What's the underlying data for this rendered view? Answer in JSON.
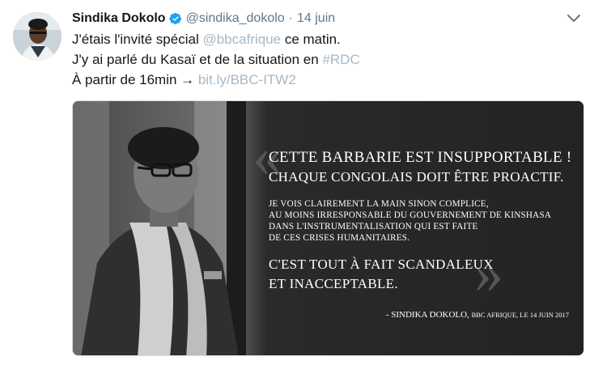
{
  "tweet": {
    "name": "Sindika Dokolo",
    "handle": "@sindika_dokolo",
    "separator": "·",
    "date": "14 juin",
    "line1_pre": "J'étais l'invité spécial ",
    "line1_mention": "@bbcafrique",
    "line1_post": " ce matin.",
    "line2_pre": "J'y ai parlé du Kasaï et de la situation en ",
    "line2_hashtag": "#RDC",
    "line3_pre": "À partir de 16min → ",
    "line3_link": "bit.ly/BBC-ITW2"
  },
  "media": {
    "open_quote": "«",
    "close_quote": "»",
    "headline1": "CETTE BARBARIE EST INSUPPORTABLE !",
    "headline2": "CHAQUE CONGOLAIS DOIT ÊTRE PROACTIF.",
    "body1": "JE VOIS CLAIREMENT LA MAIN SINON COMPLICE,",
    "body2": "AU MOINS IRRESPONSABLE DU GOUVERNEMENT DE KINSHASA",
    "body3": "DANS L'INSTRUMENTALISATION QUI EST FAITE",
    "body4": "DE CES CRISES HUMANITAIRES.",
    "closing1": "C'EST TOUT À FAIT SCANDALEUX",
    "closing2": "ET INACCEPTABLE.",
    "signature_name": "- SINDIKA DOKOLO,",
    "signature_source": "BBC AFRIQUE, LE 14 JUIN 2017"
  },
  "colors": {
    "verified": "#1da1f2",
    "link": "#a6b8c6",
    "media_bg": "#232324"
  },
  "icons": {
    "verified": "verified-badge-icon",
    "menu": "chevron-down-icon"
  }
}
